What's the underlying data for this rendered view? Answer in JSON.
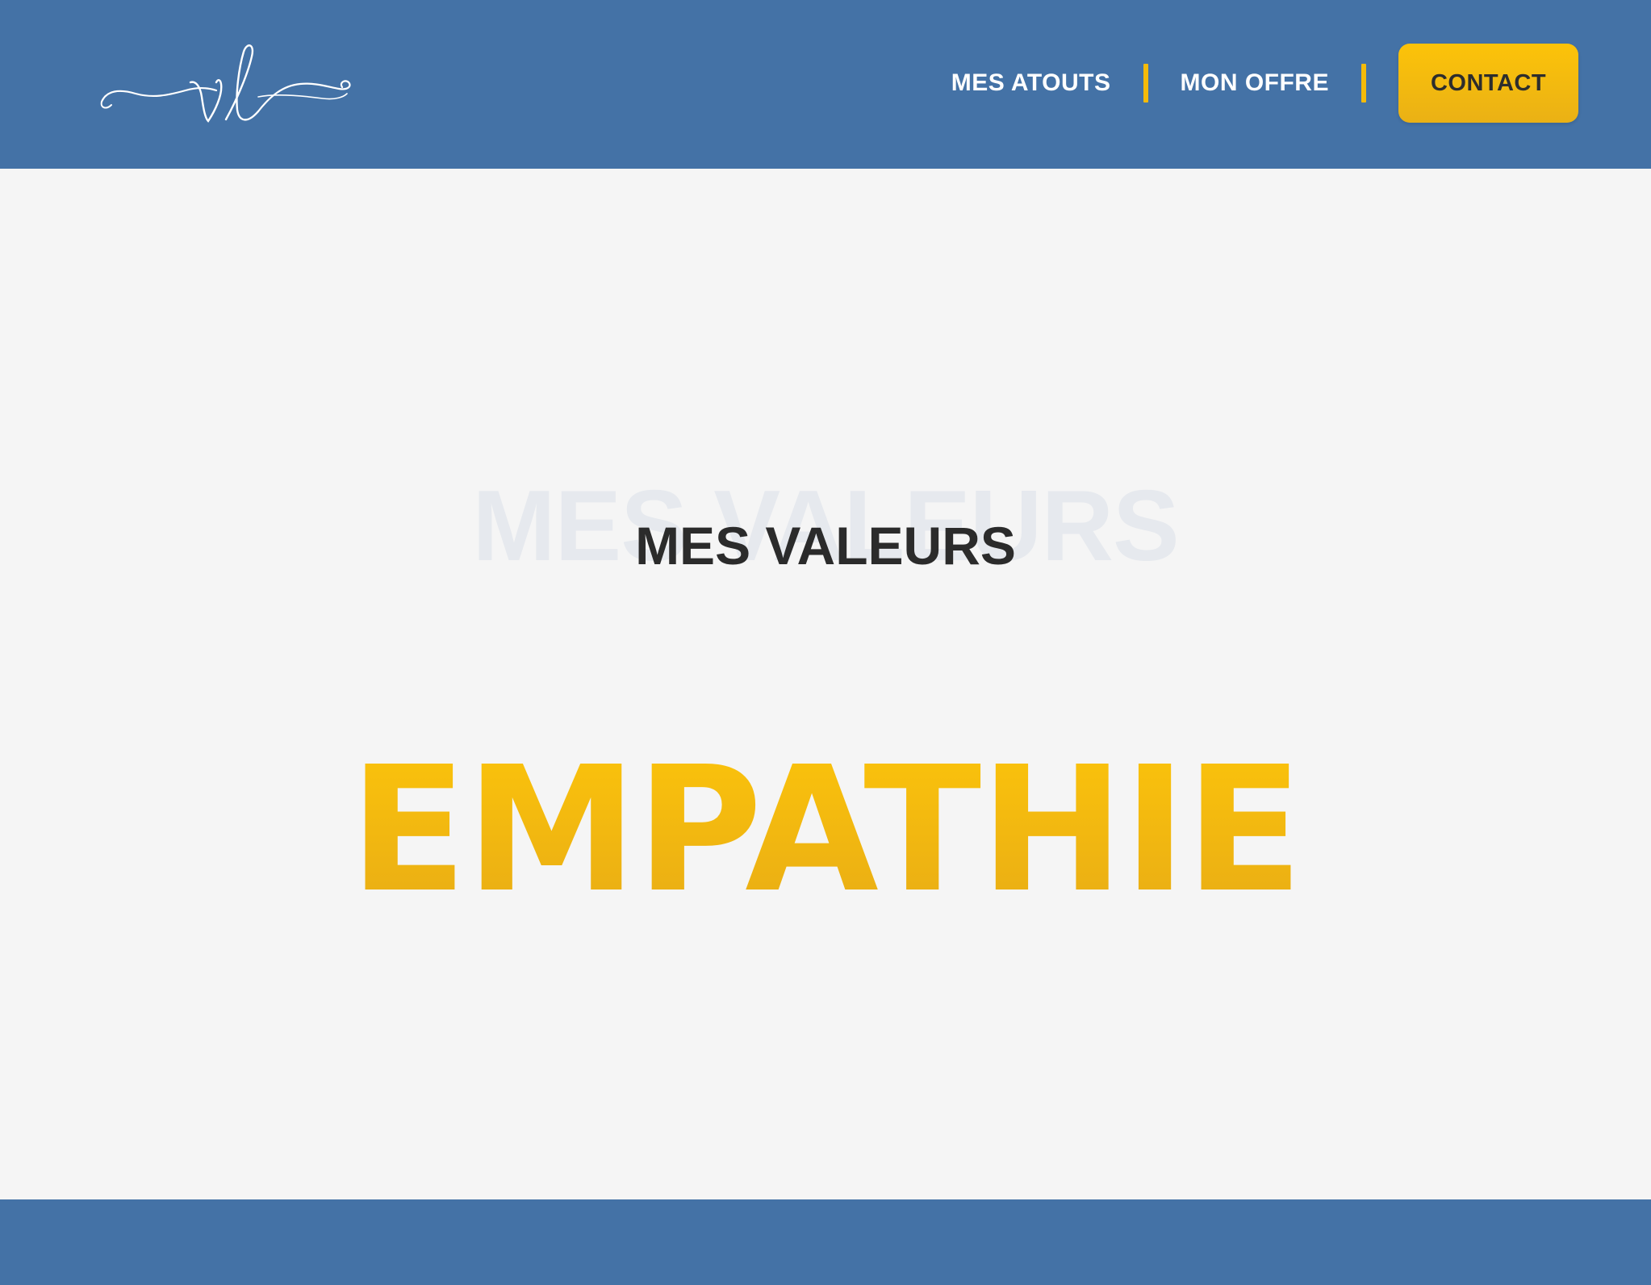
{
  "colors": {
    "header_bg": "#4472a6",
    "accent_yellow": "#f5bb0a",
    "page_bg": "#f5f5f5",
    "title_text": "#2b2b2b",
    "ghost_text": "#e6e9ee"
  },
  "header": {
    "logo_icon": "vl-script-logo",
    "nav": {
      "items": [
        {
          "label": "MES ATOUTS"
        },
        {
          "label": "MON OFFRE"
        }
      ],
      "contact_label": "CONTACT"
    }
  },
  "main": {
    "section_ghost_title": "MES VALEURS",
    "section_title": "MES VALEURS",
    "value_word": "EMPATHIE"
  }
}
